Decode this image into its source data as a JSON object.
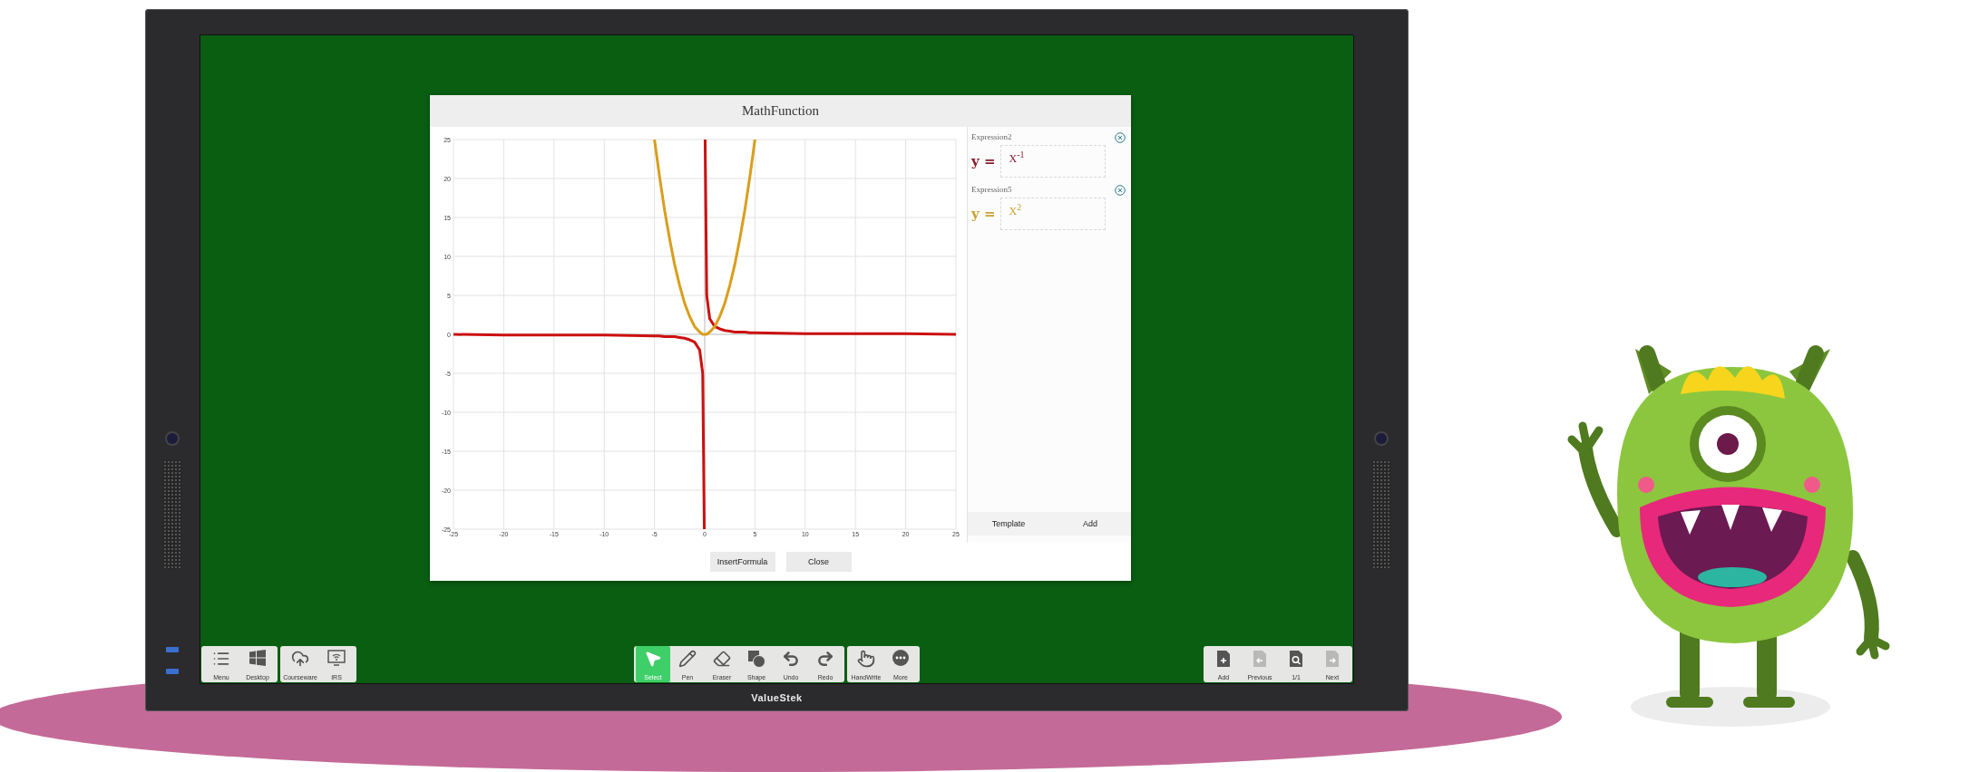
{
  "board": {
    "brand": "ValueStek"
  },
  "dialog": {
    "title": "MathFunction",
    "chart_data": {
      "type": "line",
      "grid": true,
      "x": [
        -25,
        -20,
        -15,
        -10,
        -5,
        -4.5,
        -4,
        -3.5,
        -3,
        -2.5,
        -2,
        -1.5,
        -1,
        -0.5,
        -0.2,
        -0.04,
        0,
        0.04,
        0.2,
        0.5,
        1,
        1.5,
        2,
        2.5,
        3,
        3.5,
        4,
        4.5,
        5,
        10,
        15,
        20,
        25
      ],
      "series": [
        {
          "color": "#cc1010",
          "values": [
            0,
            -0.1,
            -0.1,
            -0.1,
            -0.2,
            -0.2,
            -0.3,
            -0.3,
            -0.3,
            -0.4,
            -0.5,
            -0.7,
            -1,
            -2,
            -5,
            -25,
            null,
            25,
            5,
            2,
            1,
            0.7,
            0.5,
            0.4,
            0.3,
            0.3,
            0.3,
            0.2,
            0.2,
            0.1,
            0.1,
            0.1,
            0
          ]
        },
        {
          "color": "#d99e1c",
          "values": [
            null,
            null,
            null,
            null,
            25,
            20.3,
            16,
            12.3,
            9,
            6.3,
            4,
            2.3,
            1,
            0.3,
            0,
            0,
            0,
            0,
            0,
            0.3,
            1,
            2.3,
            4,
            6.3,
            9,
            12.3,
            16,
            20.3,
            25,
            null,
            null,
            null,
            null
          ]
        }
      ],
      "xlim": [
        -25,
        25
      ],
      "ylim": [
        -25,
        25
      ],
      "xticks": [
        -25,
        -20,
        -15,
        -10,
        -5,
        0,
        5,
        10,
        15,
        20,
        25
      ],
      "yticks": [
        -25,
        -20,
        -15,
        -10,
        -5,
        0,
        5,
        10,
        15,
        20,
        25
      ]
    },
    "expressions": [
      {
        "label": "Expression2",
        "prefix": "y =",
        "formula": "X$^{-1}$",
        "color": "#8c1c2c"
      },
      {
        "label": "Expression5",
        "prefix": "y =",
        "formula": "X$^{2}$",
        "color": "#c9a232"
      }
    ],
    "panel_buttons": [
      "Template",
      "Add"
    ],
    "buttons": [
      "InsertFormula",
      "Close"
    ]
  },
  "toolbar": {
    "left": [
      [
        {
          "label": "Menu",
          "kind": "menu"
        },
        {
          "label": "Desktop",
          "kind": "desktop"
        }
      ],
      [
        {
          "label": "Courseware",
          "kind": "courseware"
        },
        {
          "label": "IRS",
          "kind": "irs"
        }
      ]
    ],
    "center": [
      [
        {
          "label": "Select",
          "kind": "select",
          "selected": true
        },
        {
          "label": "Pen",
          "kind": "pen",
          "selected": false
        },
        {
          "label": "Eraser",
          "kind": "eraser",
          "selected": false
        },
        {
          "label": "Shape",
          "kind": "shape",
          "selected": false
        },
        {
          "label": "Undo",
          "kind": "undo",
          "selected": false
        },
        {
          "label": "Redo",
          "kind": "redo",
          "selected": false
        }
      ],
      [
        {
          "label": "HandWrite",
          "kind": "handwrite",
          "selected": false
        },
        {
          "label": "More",
          "kind": "more",
          "selected": false
        }
      ]
    ],
    "right": [
      [
        {
          "label": "Add",
          "kind": "page-add",
          "disabled": false
        },
        {
          "label": "Previous",
          "kind": "page-prev",
          "disabled": true
        },
        {
          "label": "1/1",
          "kind": "page-zoom",
          "disabled": false
        },
        {
          "label": "Next",
          "kind": "page-next",
          "disabled": true
        }
      ]
    ]
  }
}
